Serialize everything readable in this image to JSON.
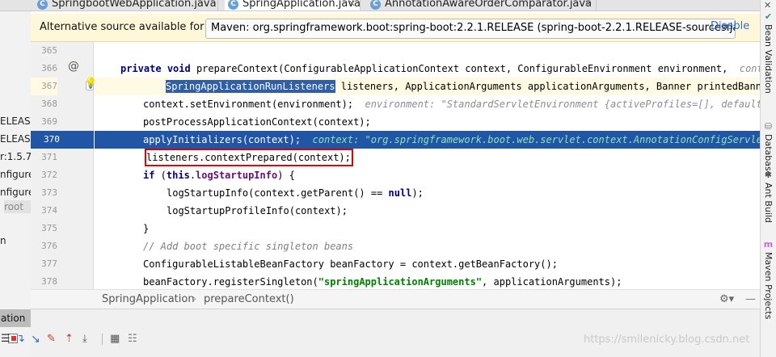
{
  "tabs": [
    {
      "label": "SpringbootWebApplication.java",
      "active": false
    },
    {
      "label": "SpringApplication.java",
      "active": true
    },
    {
      "label": "AnnotationAwareOrderComparator.java",
      "active": false
    }
  ],
  "left_panel": {
    "items": [
      "ELEASE",
      "ELEASE",
      "r:1.5.7.",
      "nfigure",
      "nfigure",
      "root",
      "n"
    ],
    "run_tab": "ation"
  },
  "notification": {
    "text": "Alternative source available for t...",
    "source_option": "Maven: org.springframework.boot:spring-boot:2.2.1.RELEASE (spring-boot-2.2.1.RELEASE-sources.jar)",
    "disable_label": "Disable"
  },
  "code": {
    "line_numbers": [
      "365",
      "366",
      "367",
      "368",
      "369",
      "370",
      "371",
      "372",
      "373",
      "374",
      "375",
      "376",
      "377",
      "378"
    ],
    "l366": {
      "kw1": "private",
      "kw2": "void",
      "text": " prepareContext(ConfigurableApplicationContext context, ConfigurableEnvironment environment,  ",
      "hint": "conte"
    },
    "l367": {
      "sel": "SpringApplicationRunListeners",
      "text": " listeners, ApplicationArguments applicationArguments, Banner printedBanner) {"
    },
    "l368": {
      "text": "context.setEnvironment(environment);  ",
      "hint": "environment: \"StandardServletEnvironment {activeProfiles=[], defaultPro"
    },
    "l369": {
      "text": "postProcessApplicationContext(context);"
    },
    "l370": {
      "text": "applyInitializers(context);  ",
      "hint": "context: \"org.springframework.boot.web.servlet.context.AnnotationConfigServletWe"
    },
    "l371": {
      "text": "listeners.contextPrepared(context);"
    },
    "l372": {
      "kw": "if",
      "open": " (",
      "kw2": "this",
      "dot": ".",
      "field": "logStartupInfo",
      "close": ") {"
    },
    "l373": {
      "text": "logStartupInfo(context.getParent() == ",
      "kw": "null",
      "close": ");"
    },
    "l374": {
      "text": "logStartupProfileInfo(context);"
    },
    "l375": {
      "text": "}"
    },
    "l376": {
      "comment": "// Add boot specific singleton beans"
    },
    "l377": {
      "text": "ConfigurableListableBeanFactory beanFactory = context.getBeanFactory();"
    },
    "l378": {
      "pre": "beanFactory.registerSingleton(",
      "str": "\"springApplicationArguments\"",
      "post": ", applicationArguments);"
    }
  },
  "breadcrumb": {
    "class_name": "SpringApplication",
    "sep": "›",
    "method": "prepareContext()"
  },
  "right_sidebar": {
    "items": [
      "Bean Validation",
      "Database",
      "Ant Build",
      "Maven Projects"
    ]
  },
  "watermark": "https://smilenicky.blog.csdn.net"
}
